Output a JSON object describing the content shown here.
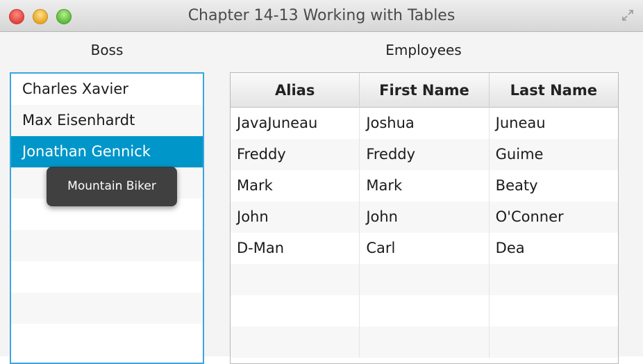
{
  "window": {
    "title": "Chapter 14-13 Working with Tables"
  },
  "boss": {
    "label": "Boss",
    "items": [
      {
        "name": "Charles Xavier"
      },
      {
        "name": "Max Eisenhardt"
      },
      {
        "name": "Jonathan Gennick"
      }
    ],
    "selected_index": 2,
    "tooltip": "Mountain Biker"
  },
  "employees": {
    "label": "Employees",
    "columns": [
      "Alias",
      "First Name",
      "Last Name"
    ],
    "rows": [
      [
        "JavaJuneau",
        "Joshua",
        "Juneau"
      ],
      [
        "Freddy",
        "Freddy",
        "Guime"
      ],
      [
        "Mark",
        "Mark",
        "Beaty"
      ],
      [
        "John",
        "John",
        "O'Conner"
      ],
      [
        "D-Man",
        "Carl",
        "Dea"
      ]
    ]
  },
  "colors": {
    "selection": "#0096c9",
    "focus_border": "#39a5de"
  }
}
